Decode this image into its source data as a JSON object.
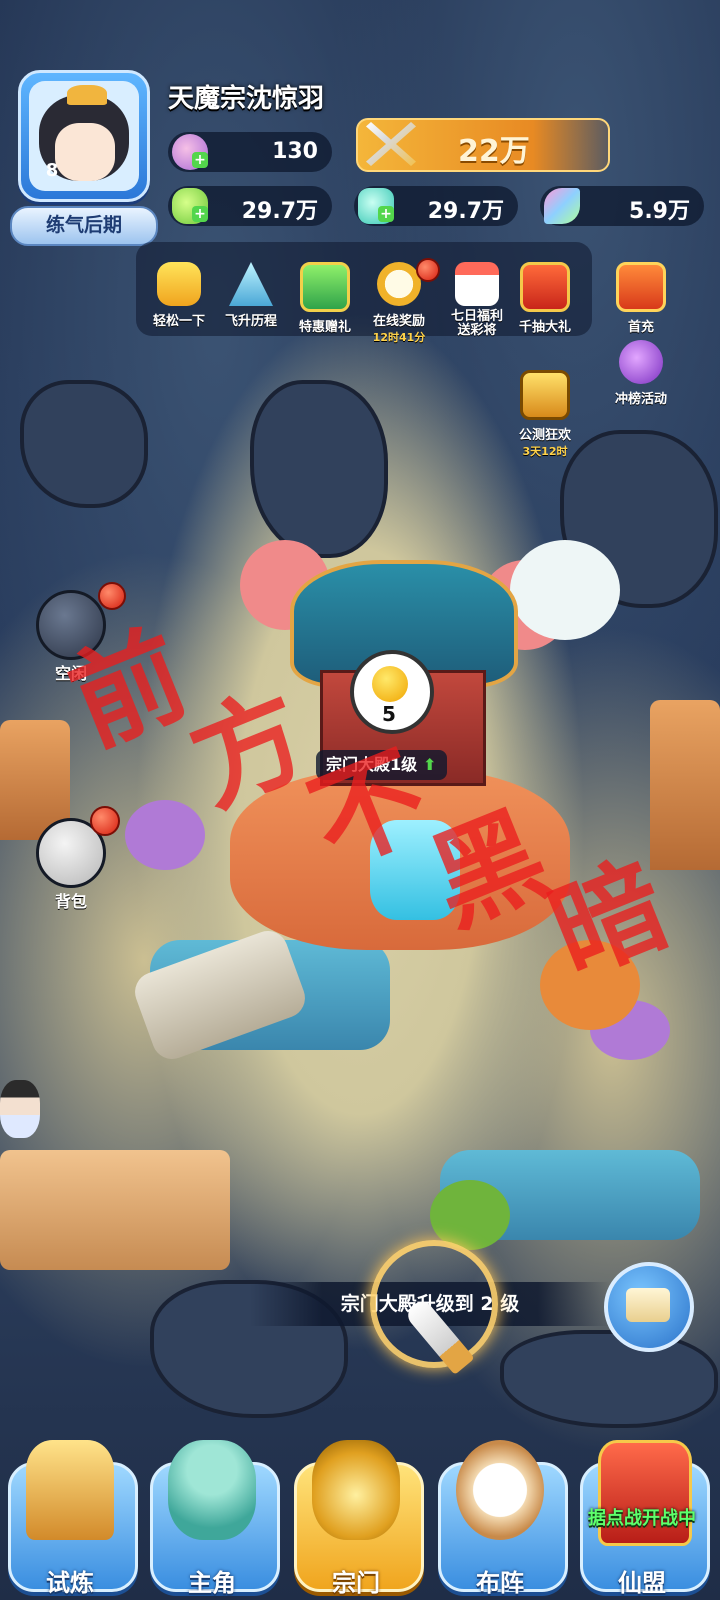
{
  "player": {
    "name": "天魔宗沈惊羽",
    "level": "8",
    "realm": "练气后期"
  },
  "resources": {
    "stamina": "130",
    "power": "22万",
    "jade": "29.7万",
    "spirit_stone": "29.7万",
    "feather": "5.9万"
  },
  "events": [
    {
      "label": "轻松一下",
      "sub": ""
    },
    {
      "label": "飞升历程",
      "sub": ""
    },
    {
      "label": "特惠赠礼",
      "sub": ""
    },
    {
      "label": "在线奖励",
      "sub": "12时41分"
    },
    {
      "label": "七日福利送彩将",
      "sub": ""
    },
    {
      "label": "千抽大礼",
      "sub": ""
    },
    {
      "label": "首充",
      "sub": ""
    },
    {
      "label": "冲榜活动",
      "sub": ""
    },
    {
      "label": "公测狂欢",
      "sub": "3天12时"
    }
  ],
  "side_buttons": {
    "idle": "空闲",
    "bag": "背包"
  },
  "hall": {
    "label": "宗门大殿1级",
    "bubble_count": "5"
  },
  "task": {
    "text": "宗门大殿升级到 2 级"
  },
  "watermark": [
    "前",
    "方",
    "不",
    "黑",
    "暗"
  ],
  "nav": [
    {
      "label": "试炼"
    },
    {
      "label": "主角"
    },
    {
      "label": "宗门"
    },
    {
      "label": "布阵"
    },
    {
      "label": "仙盟",
      "banner": "据点战开战中"
    }
  ],
  "colors": {
    "accent_gold": "#f0a51e",
    "accent_blue": "#3a8ee0",
    "alert_red": "#d61f10",
    "banner_green": "#5dff6b"
  }
}
